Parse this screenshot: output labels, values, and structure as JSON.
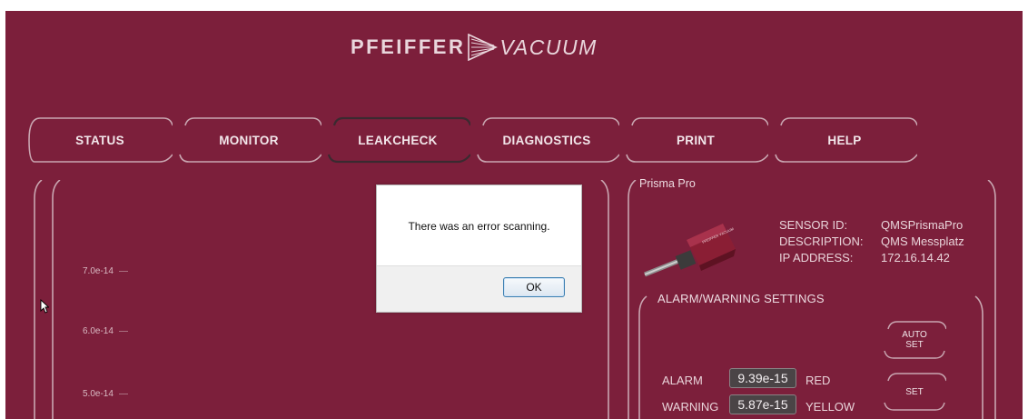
{
  "brand": {
    "left": "PFEIFFER",
    "right": "VACUUM"
  },
  "nav": {
    "tabs": [
      {
        "label": "STATUS",
        "active": false
      },
      {
        "label": "MONITOR",
        "active": false
      },
      {
        "label": "LEAKCHECK",
        "active": true
      },
      {
        "label": "DIAGNOSTICS",
        "active": false
      },
      {
        "label": "PRINT",
        "active": false
      },
      {
        "label": "HELP",
        "active": false
      }
    ]
  },
  "chart": {
    "y_ticks": [
      "7.0e-14",
      "6.0e-14",
      "5.0e-14"
    ]
  },
  "dialog": {
    "message": "There was an error scanning.",
    "ok_label": "OK"
  },
  "device": {
    "title": "Prisma Pro",
    "sensor_id_label": "SENSOR ID:",
    "sensor_id": "QMSPrismaPro",
    "description_label": "DESCRIPTION:",
    "description": "QMS Messplatz",
    "ip_label": "IP ADDRESS:",
    "ip": "172.16.14.42"
  },
  "alarm": {
    "title": "ALARM/WARNING SETTINGS",
    "auto_set_line1": "AUTO",
    "auto_set_line2": "SET",
    "set_label": "SET",
    "alarm_label": "ALARM",
    "alarm_value": "9.39e-15",
    "alarm_color": "RED",
    "warning_label": "WARNING",
    "warning_value": "5.87e-15",
    "warning_color": "YELLOW"
  },
  "colors": {
    "background": "#7c1f3b",
    "text": "#e9d4da",
    "value_box": "#4a4446"
  }
}
